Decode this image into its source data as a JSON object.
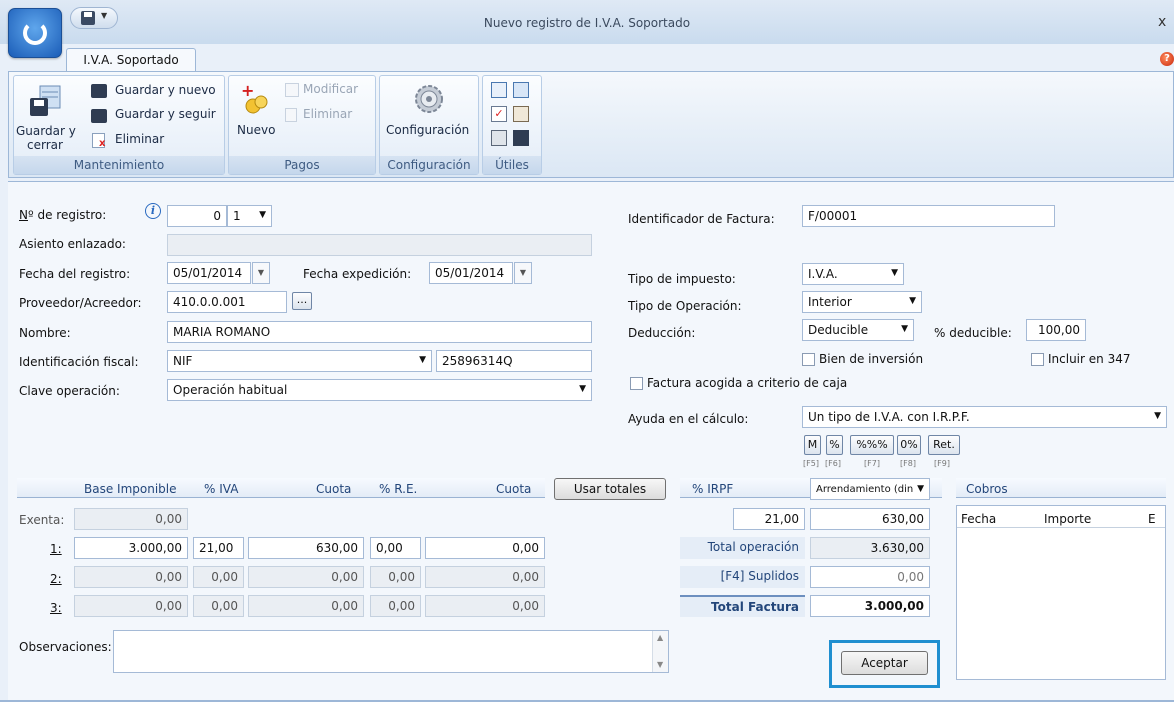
{
  "window": {
    "title": "Nuevo registro de I.V.A. Soportado",
    "close": "x"
  },
  "ribbon": {
    "tab": "I.V.A. Soportado",
    "help": "?",
    "groups": {
      "mantenimiento": {
        "label": "Mantenimiento",
        "guardar_cerrar_1": "Guardar y",
        "guardar_cerrar_2": "cerrar",
        "guardar_nuevo": "Guardar y nuevo",
        "guardar_seguir": "Guardar y seguir",
        "eliminar": "Eliminar"
      },
      "pagos": {
        "label": "Pagos",
        "nuevo": "Nuevo",
        "modificar": "Modificar",
        "eliminar": "Eliminar"
      },
      "configuracion": {
        "label": "Configuración",
        "button": "Configuración"
      },
      "utiles": {
        "label": "Útiles"
      }
    }
  },
  "form": {
    "n_registro": {
      "label": "Nº de registro:",
      "value": "0",
      "serie": "1"
    },
    "asiento": {
      "label": "Asiento enlazado:",
      "value": ""
    },
    "fecha_registro": {
      "label": "Fecha del registro:",
      "value": "05/01/2014"
    },
    "fecha_expedicion": {
      "label": "Fecha expedición:",
      "value": "05/01/2014"
    },
    "proveedor": {
      "label": "Proveedor/Acreedor:",
      "value": "410.0.0.001",
      "browse": "..."
    },
    "nombre": {
      "label": "Nombre:",
      "value": "MARIA ROMANO"
    },
    "ident_fiscal": {
      "label": "Identificación fiscal:",
      "type": "NIF",
      "value": "25896314Q"
    },
    "clave": {
      "label": "Clave operación:",
      "value": "Operación habitual"
    },
    "identificador_factura": {
      "label": "Identificador de Factura:",
      "value": "F/00001"
    },
    "tipo_impuesto": {
      "label": "Tipo de impuesto:",
      "value": "I.V.A."
    },
    "tipo_operacion": {
      "label": "Tipo de Operación:",
      "value": "Interior"
    },
    "deduccion": {
      "label": "Deducción:",
      "value": "Deducible"
    },
    "pct_deducible": {
      "label": "% deducible:",
      "value": "100,00"
    },
    "bien_inversion": {
      "label": "Bien de inversión",
      "checked": false
    },
    "incluir_347": {
      "label": "Incluir en 347",
      "checked": false
    },
    "criterio_caja": {
      "label": "Factura acogida a criterio de caja",
      "checked": false
    },
    "ayuda_calculo": {
      "label": "Ayuda en el cálculo:",
      "value": "Un tipo de I.V.A. con I.R.P.F."
    },
    "calc_buttons": [
      {
        "label": "M",
        "key": "[F5]"
      },
      {
        "label": "%",
        "key": "[F6]"
      },
      {
        "label": "%%%",
        "key": "[F7]"
      },
      {
        "label": "0%",
        "key": "[F8]"
      },
      {
        "label": "Ret.",
        "key": "[F9]"
      }
    ]
  },
  "table": {
    "headers": {
      "base": "Base Imponible",
      "pct_iva": "% IVA",
      "cuota": "Cuota",
      "pct_re": "% R.E.",
      "cuota_re": "Cuota",
      "usar_totales": "Usar totales"
    },
    "exenta": {
      "label": "Exenta:",
      "base": "0,00"
    },
    "rows": [
      {
        "label": "1:",
        "base": "3.000,00",
        "iva": "21,00",
        "cuota": "630,00",
        "re": "0,00",
        "cuota_re": "0,00"
      },
      {
        "label": "2:",
        "base": "0,00",
        "iva": "0,00",
        "cuota": "0,00",
        "re": "0,00",
        "cuota_re": "0,00"
      },
      {
        "label": "3:",
        "base": "0,00",
        "iva": "0,00",
        "cuota": "0,00",
        "re": "0,00",
        "cuota_re": "0,00"
      }
    ]
  },
  "irpf": {
    "header": "% IRPF",
    "type": "Arrendamiento (din",
    "pct": "21,00",
    "amount": "630,00",
    "total_operacion_label": "Total operación",
    "total_operacion": "3.630,00",
    "suplidos_label": "[F4] Suplidos",
    "suplidos": "0,00",
    "total_factura_label": "Total Factura",
    "total_factura": "3.000,00"
  },
  "cobros": {
    "title": "Cobros",
    "columns": [
      "Fecha",
      "Importe",
      "E"
    ]
  },
  "observaciones": {
    "label": "Observaciones:",
    "value": ""
  },
  "aceptar": "Aceptar",
  "colors": {
    "accent": "#1f8fd0",
    "header_text": "#23467a"
  }
}
